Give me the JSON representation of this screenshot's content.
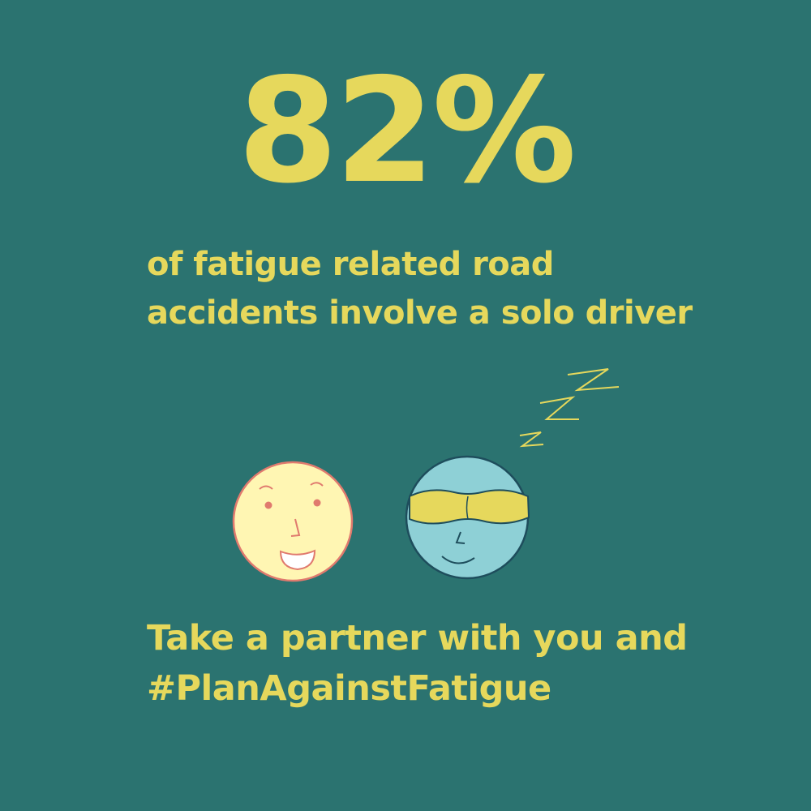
{
  "headline": {
    "value": "82%"
  },
  "statement": {
    "line1": "of fatigue related road",
    "line2": "accidents involve a solo driver"
  },
  "call_to_action": {
    "line1": "Take a partner with you and",
    "line2": "#PlanAgainstFatigue"
  },
  "illustration": {
    "awake_face_icon": "awake-face-icon",
    "sleeping_face_icon": "sleeping-face-icon",
    "sleep_symbol_icon": "zzz-icon"
  },
  "colors": {
    "background": "#2b7370",
    "accent_yellow": "#e6d85c",
    "awake_face_fill": "#fff6b3",
    "awake_face_outline": "#e07a6e",
    "sleeping_face_fill": "#8ed0d6",
    "sleeping_face_outline": "#1e4d5c",
    "mask_fill": "#e6d85c"
  }
}
